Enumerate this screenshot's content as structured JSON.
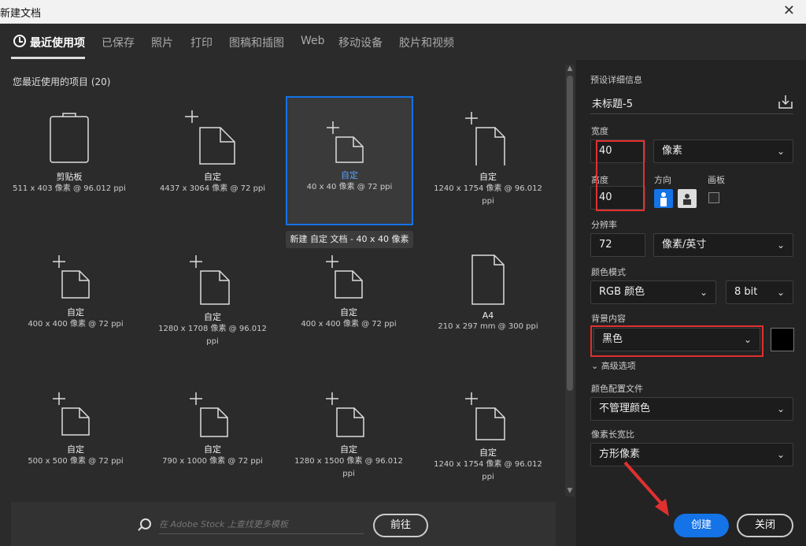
{
  "window": {
    "title": "新建文档",
    "close": "✕"
  },
  "tabs": [
    "最近使用项",
    "已保存",
    "照片",
    "打印",
    "图稿和插图",
    "Web",
    "移动设备",
    "胶片和视频"
  ],
  "recent": {
    "title": "您最近使用的项目 (20)",
    "items": [
      {
        "name": "剪贴板",
        "dims": "511 x 403 像素 @ 96.012 ppi"
      },
      {
        "name": "自定",
        "dims": "4437 x 3064 像素 @ 72 ppi"
      },
      {
        "name": "自定",
        "dims": "40 x 40 像素 @ 72 ppi"
      },
      {
        "name": "自定",
        "dims": "1240 x 1754 像素 @ 96.012 ppi"
      },
      {
        "name": "自定",
        "dims": "400 x 400 像素 @ 72 ppi"
      },
      {
        "name": "自定",
        "dims": "1280 x 1708 像素 @ 96.012 ppi"
      },
      {
        "name": "自定",
        "dims": "400 x 400 像素 @ 72 ppi"
      },
      {
        "name": "A4",
        "dims": "210 x 297 mm @ 300 ppi"
      },
      {
        "name": "自定",
        "dims": "500 x 500 像素 @ 72 ppi"
      },
      {
        "name": "自定",
        "dims": "790 x 1000 像素 @ 72 ppi"
      },
      {
        "name": "自定",
        "dims": "1280 x 1500 像素 @ 96.012 ppi"
      },
      {
        "name": "自定",
        "dims": "1240 x 1754 像素 @ 96.012 ppi"
      }
    ],
    "tooltip": "新建 自定 文档 - 40 x 40 像素"
  },
  "stock": {
    "placeholder": "在 Adobe Stock 上查找更多模板",
    "go": "前往"
  },
  "preset": {
    "heading": "预设详细信息",
    "doc_name": "未标题-5",
    "width_label": "宽度",
    "width": "40",
    "width_unit": "像素",
    "height_label": "高度",
    "height": "40",
    "orientation_label": "方向",
    "artboard_label": "画板",
    "resolution_label": "分辨率",
    "resolution": "72",
    "resolution_unit": "像素/英寸",
    "color_mode_label": "颜色模式",
    "color_mode": "RGB 颜色",
    "bit_depth": "8 bit",
    "bg_label": "背景内容",
    "bg": "黑色",
    "advanced": "高级选项",
    "profile_label": "颜色配置文件",
    "profile": "不管理颜色",
    "aspect_label": "像素长宽比",
    "aspect": "方形像素"
  },
  "actions": {
    "create": "创建",
    "close": "关闭"
  },
  "colors": {
    "accent": "#1473e6",
    "highlight": "#e03030"
  }
}
